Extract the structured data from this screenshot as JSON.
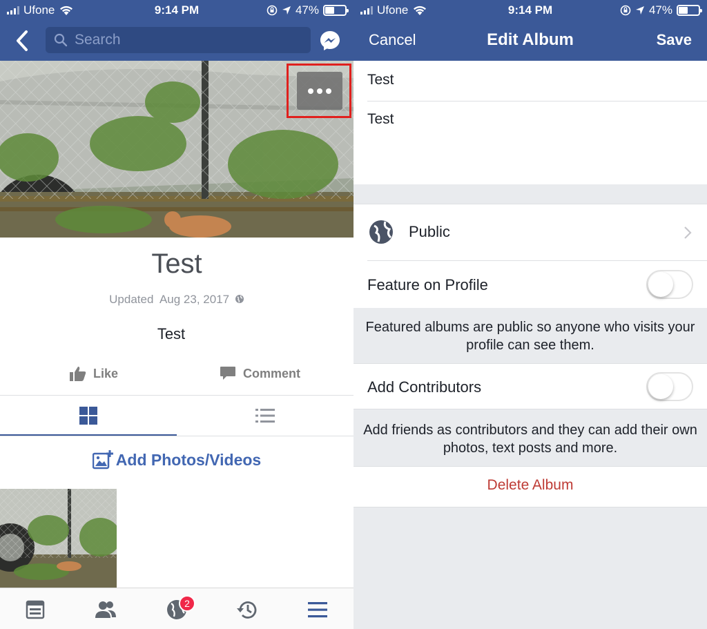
{
  "status_bar": {
    "carrier": "Ufone",
    "time": "9:14 PM",
    "battery_percent": "47%",
    "battery_level": 0.47
  },
  "left": {
    "search": {
      "placeholder": "Search"
    },
    "album": {
      "title": "Test",
      "updated_label": "Updated",
      "updated_date": "Aug 23, 2017",
      "description": "Test"
    },
    "actions": {
      "like": "Like",
      "comment": "Comment"
    },
    "add_photos": "Add Photos/Videos",
    "tabbar": {
      "notifications_badge": "2"
    },
    "icons": [
      "back-icon",
      "search-icon",
      "messenger-icon",
      "more-icon",
      "like-icon",
      "comment-icon",
      "grid-icon",
      "list-icon",
      "add-photo-icon",
      "news-feed-icon",
      "friends-icon",
      "notifications-globe-icon",
      "history-icon",
      "menu-icon"
    ]
  },
  "right": {
    "nav": {
      "cancel": "Cancel",
      "title": "Edit Album",
      "save": "Save"
    },
    "name_field": "Test",
    "description_field": "Test",
    "privacy": {
      "label": "Public",
      "icon": "globe-icon"
    },
    "feature_on_profile": {
      "label": "Feature on Profile",
      "enabled": false,
      "note": "Featured albums are public so anyone who visits your profile can see them."
    },
    "add_contributors": {
      "label": "Add Contributors",
      "enabled": false,
      "note": "Add friends as contributors and they can add their own photos, text posts and more."
    },
    "delete_album": "Delete Album"
  },
  "colors": {
    "facebook_blue": "#3b5998",
    "link_blue": "#4267b2",
    "delete_red": "#be3b35",
    "highlight_red": "#e0201d",
    "badge_red": "#f02849"
  }
}
